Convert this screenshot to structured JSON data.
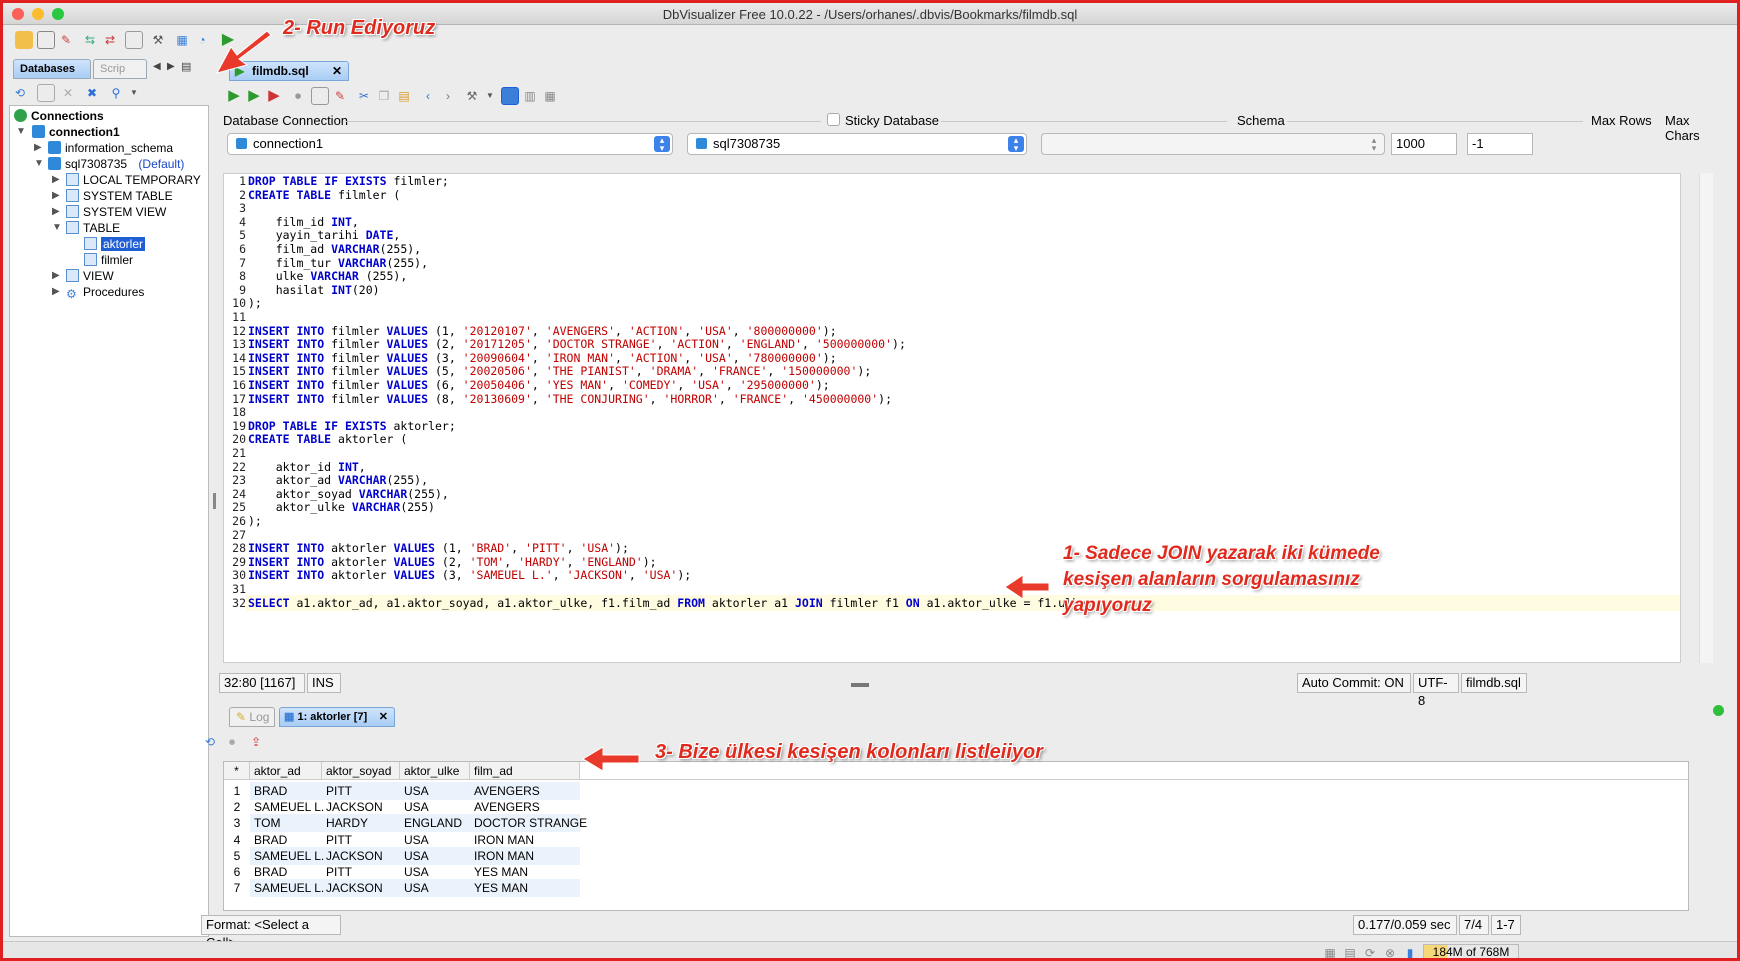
{
  "window": {
    "title": "DbVisualizer Free 10.0.22 - /Users/orhanes/.dbvis/Bookmarks/filmdb.sql"
  },
  "left_panel": {
    "tabs": [
      "Databases",
      "Scrip"
    ],
    "tree": {
      "root": "Connections",
      "connection": "connection1",
      "schemas": [
        "information_schema",
        "sql7308735"
      ],
      "default_label": "(Default)",
      "folders": [
        "LOCAL TEMPORARY",
        "SYSTEM TABLE",
        "SYSTEM VIEW",
        "TABLE"
      ],
      "tables": [
        "aktorler",
        "filmler"
      ],
      "after": [
        "VIEW",
        "Procedures"
      ]
    }
  },
  "editor": {
    "tab_label": "filmdb.sql",
    "labels": {
      "db_connection": "Database Connection",
      "sticky": "Sticky Database",
      "schema": "Schema",
      "max_rows": "Max Rows",
      "max_chars": "Max Chars"
    },
    "connection": "connection1",
    "database": "sql7308735",
    "schema": "",
    "max_rows": "1000",
    "max_chars": "-1",
    "lines": [
      "DROP TABLE IF EXISTS filmler;",
      "CREATE TABLE filmler (",
      "",
      "    film_id INT,",
      "    yayin_tarihi DATE,",
      "    film_ad VARCHAR(255),",
      "    film_tur VARCHAR(255),",
      "    ulke VARCHAR (255),",
      "    hasilat INT(20)",
      ");",
      "",
      "INSERT INTO filmler VALUES (1, '20120107', 'AVENGERS', 'ACTION', 'USA', '800000000');",
      "INSERT INTO filmler VALUES (2, '20171205', 'DOCTOR STRANGE', 'ACTION', 'ENGLAND', '500000000');",
      "INSERT INTO filmler VALUES (3, '20090604', 'IRON MAN', 'ACTION', 'USA', '780000000');",
      "INSERT INTO filmler VALUES (5, '20020506', 'THE PIANIST', 'DRAMA', 'FRANCE', '150000000');",
      "INSERT INTO filmler VALUES (6, '20050406', 'YES MAN', 'COMEDY', 'USA', '295000000');",
      "INSERT INTO filmler VALUES (8, '20130609', 'THE CONJURING', 'HORROR', 'FRANCE', '450000000');",
      "",
      "DROP TABLE IF EXISTS aktorler;",
      "CREATE TABLE aktorler (",
      "",
      "    aktor_id INT,",
      "    aktor_ad VARCHAR(255),",
      "    aktor_soyad VARCHAR(255),",
      "    aktor_ulke VARCHAR(255)",
      ");",
      "",
      "INSERT INTO aktorler VALUES (1, 'BRAD', 'PITT', 'USA');",
      "INSERT INTO aktorler VALUES (2, 'TOM', 'HARDY', 'ENGLAND');",
      "INSERT INTO aktorler VALUES (3, 'SAMEUEL L.', 'JACKSON', 'USA');",
      "",
      "SELECT a1.aktor_ad, a1.aktor_soyad, a1.aktor_ulke, f1.film_ad FROM aktorler a1 JOIN filmler f1 ON a1.aktor_ulke = f1.ulke"
    ]
  },
  "status": {
    "position": "32:80 [1167]",
    "mode": "INS",
    "auto_commit": "Auto Commit: ON",
    "encoding": "UTF-8",
    "file": "filmdb.sql"
  },
  "results": {
    "tabs": [
      "Log",
      "1: aktorler [7]"
    ],
    "columns": [
      "*",
      "aktor_ad",
      "aktor_soyad",
      "aktor_ulke",
      "film_ad"
    ],
    "rows": [
      [
        "1",
        "BRAD",
        "PITT",
        "USA",
        "AVENGERS"
      ],
      [
        "2",
        "SAMEUEL L.",
        "JACKSON",
        "USA",
        "AVENGERS"
      ],
      [
        "3",
        "TOM",
        "HARDY",
        "ENGLAND",
        "DOCTOR STRANGE"
      ],
      [
        "4",
        "BRAD",
        "PITT",
        "USA",
        "IRON MAN"
      ],
      [
        "5",
        "SAMEUEL L.",
        "JACKSON",
        "USA",
        "IRON MAN"
      ],
      [
        "6",
        "BRAD",
        "PITT",
        "USA",
        "YES MAN"
      ],
      [
        "7",
        "SAMEUEL L.",
        "JACKSON",
        "USA",
        "YES MAN"
      ]
    ],
    "format": "Format: <Select a Cell>",
    "timing": "0.177/0.059 sec",
    "row_pos": "7/4",
    "range": "1-7"
  },
  "memory": "184M of 768M",
  "annotations": {
    "a1": "1- Sadece JOIN yazarak iki kümede",
    "a1b": "kesişen alanların sorgulamasınız",
    "a1c": "yapıyoruz",
    "a2": "2- Run Ediyoruz",
    "a3": "3- Bize ülkesi kesişen kolonları listleiiyor"
  },
  "colors": {
    "annotation": "#e02a1e",
    "keyword": "#0000cc",
    "string": "#c00000",
    "selection": "#1f5fd6"
  }
}
